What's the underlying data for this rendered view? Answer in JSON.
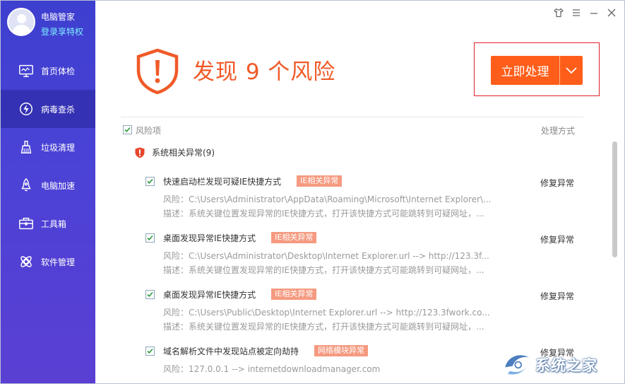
{
  "window": {
    "title_buttons": [
      {
        "name": "skin-icon"
      },
      {
        "name": "menu-icon"
      },
      {
        "name": "minimize-icon"
      },
      {
        "name": "close-icon"
      }
    ]
  },
  "sidebar": {
    "app_name": "电脑管家",
    "login_text": "登录享特权",
    "items": [
      {
        "label": "首页体检",
        "icon": "monitor-icon",
        "active": false
      },
      {
        "label": "病毒查杀",
        "icon": "lightning-icon",
        "active": true
      },
      {
        "label": "垃圾清理",
        "icon": "broom-icon",
        "active": false
      },
      {
        "label": "电脑加速",
        "icon": "rocket-icon",
        "active": false
      },
      {
        "label": "工具箱",
        "icon": "toolbox-icon",
        "active": false
      },
      {
        "label": "软件管理",
        "icon": "apps-icon",
        "active": false
      }
    ]
  },
  "header": {
    "headline": "发现 9 个风险",
    "action_label": "立即处理"
  },
  "list": {
    "col_risk": "风险项",
    "col_action": "处理方式",
    "group_label": "系统相关异常(9)",
    "items": [
      {
        "title": "快速启动栏发现可疑IE快捷方式",
        "tag": "IE相关异常",
        "action": "修复异常",
        "risk": "风险：C:\\Users\\Administrator\\AppData\\Roaming\\Microsoft\\Internet Explorer\\...",
        "desc": "描述：系统关键位置发现异常的IE快捷方式，打开该快捷方式可能跳转到可疑网址，..."
      },
      {
        "title": "桌面发现异常IE快捷方式",
        "tag": "IE相关异常",
        "action": "修复异常",
        "risk": "风险：C:\\Users\\Administrator\\Desktop\\Internet Explorer.url --> http://123.3f...",
        "desc": "描述：系统关键位置发现异常的IE快捷方式，打开该快捷方式可能跳转到可疑网址，..."
      },
      {
        "title": "桌面发现异常IE快捷方式",
        "tag": "IE相关异常",
        "action": "修复异常",
        "risk": "风险：C:\\Users\\Public\\Desktop\\Internet Explorer.url --> http://123.3fwork.co...",
        "desc": "描述：系统关键位置发现异常的IE快捷方式，打开该快捷方式可能跳转到可疑网址，..."
      },
      {
        "title": "域名解析文件中发现站点被定向劫持",
        "tag": "网络模块异常",
        "action": "修复异常",
        "risk": "风险：127.0.0.1 --> internetdownloadmanager.com",
        "desc": ""
      }
    ]
  },
  "watermark": {
    "text": "系统之家"
  },
  "colors": {
    "accent_orange": "#ff5e1a",
    "headline_orange": "#f05a28",
    "tag_bg": "#f59a80",
    "sidebar_blue": "#4a42d6",
    "login_cyan": "#7ef0ff"
  }
}
